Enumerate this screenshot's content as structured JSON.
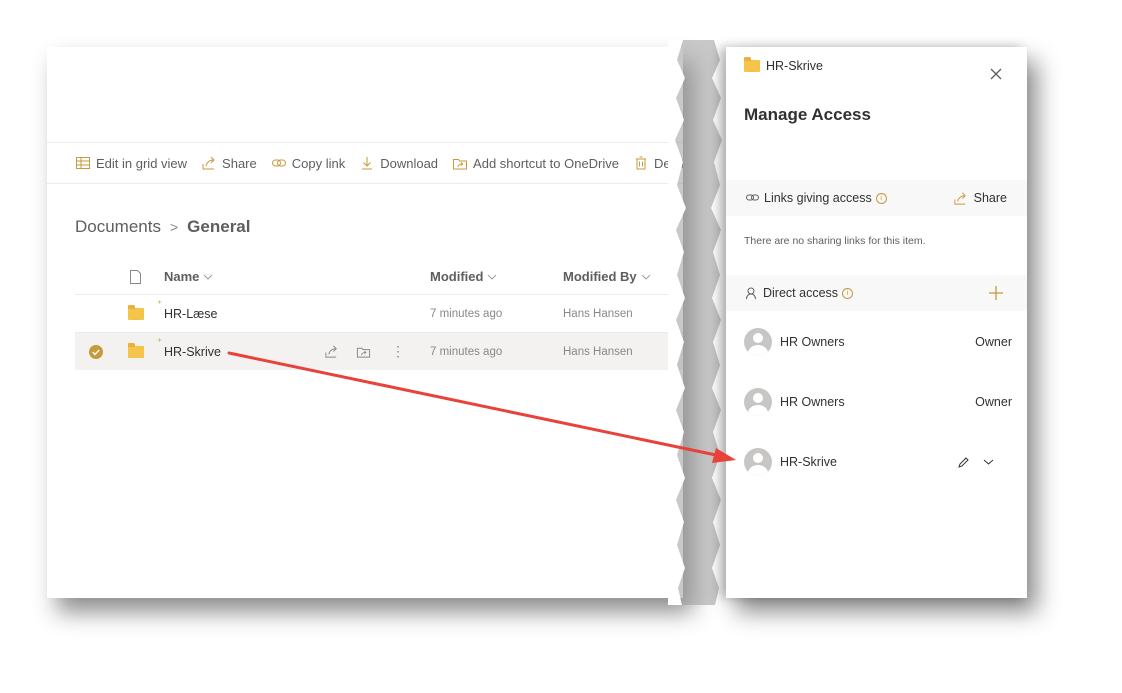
{
  "toolbar": {
    "items": [
      {
        "icon": "grid-icon",
        "label": "Edit in grid view"
      },
      {
        "icon": "share-icon",
        "label": "Share"
      },
      {
        "icon": "link-icon",
        "label": "Copy link"
      },
      {
        "icon": "download-icon",
        "label": "Download"
      },
      {
        "icon": "shortcut-icon",
        "label": "Add shortcut to OneDrive"
      },
      {
        "icon": "trash-icon",
        "label": "Delete"
      }
    ]
  },
  "breadcrumb": {
    "parent": "Documents",
    "separator": ">",
    "current": "General"
  },
  "columns": {
    "name": "Name",
    "modified": "Modified",
    "modified_by": "Modified By"
  },
  "files": [
    {
      "name": "HR-Læse",
      "modified": "7 minutes ago",
      "modified_by": "Hans Hansen",
      "selected": false
    },
    {
      "name": "HR-Skrive",
      "modified": "7 minutes ago",
      "modified_by": "Hans Hansen",
      "selected": true
    }
  ],
  "manage_access": {
    "item_name": "HR-Skrive",
    "title": "Manage Access",
    "links_section": {
      "label": "Links giving access",
      "share_label": "Share",
      "empty_text": "There are no sharing links for this item."
    },
    "direct_section": {
      "label": "Direct access"
    },
    "people": [
      {
        "name": "HR Owners",
        "role": "Owner"
      },
      {
        "name": "HR Owners",
        "role": "Owner"
      },
      {
        "name": "HR-Skrive",
        "role": ""
      }
    ]
  },
  "colors": {
    "accent": "#c79a3a",
    "arrow": "#e8423a",
    "folder": "#f5c44b"
  }
}
